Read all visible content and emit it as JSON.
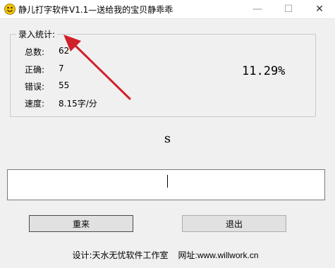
{
  "window": {
    "title": "静儿打字软件V1.1—送给我的宝贝静乖乖",
    "min_glyph": "—",
    "max_glyph": "☐",
    "close_glyph": "✕",
    "icon": "smiley-icon"
  },
  "stats": {
    "legend": "录入统计:",
    "total_label": "总数:",
    "total_value": "62",
    "correct_label": "正确:",
    "correct_value": "7",
    "error_label": "错误:",
    "error_value": "55",
    "speed_label": "速度:",
    "speed_value": "8.15字/分",
    "accuracy": "11.29%"
  },
  "practice": {
    "target_char": "s",
    "input_value": ""
  },
  "buttons": {
    "reset_label": "重来",
    "exit_label": "退出"
  },
  "footer": {
    "design_text": "设计:天水无忧软件工作室",
    "website_text": "网址:www.willwork.cn"
  },
  "colors": {
    "annotation_arrow": "#d0202a",
    "icon_face": "#f2c200"
  }
}
